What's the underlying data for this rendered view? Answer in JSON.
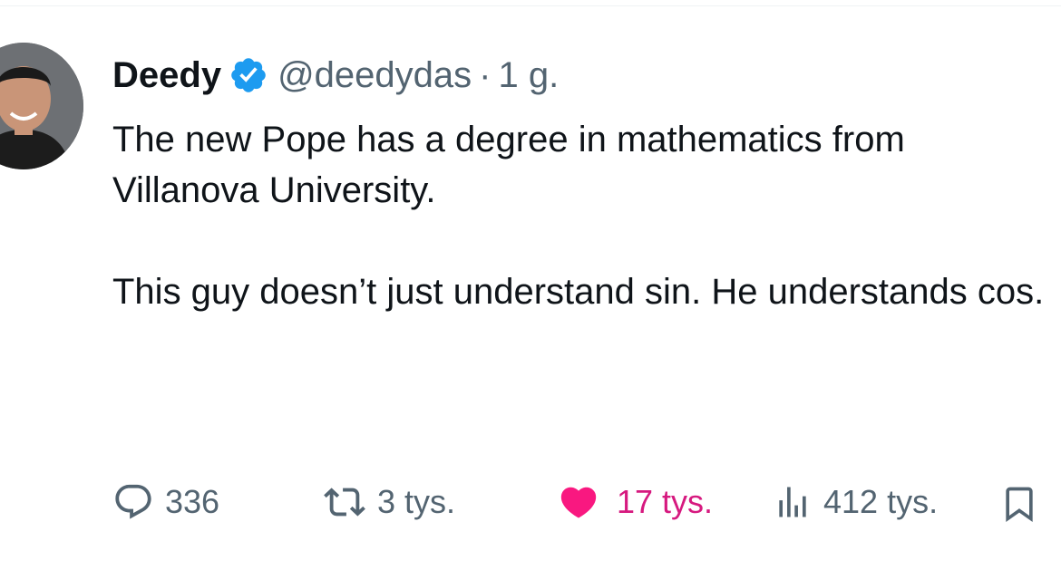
{
  "tweet": {
    "author": {
      "name": "Deedy",
      "handle": "@deedydas",
      "verified": true,
      "verified_icon": "verified-badge-icon"
    },
    "separator": "·",
    "time": "1 g.",
    "paragraphs": [
      "The new Pope has a degree in mathematics from Villanova University.",
      "This guy doesn’t just understand sin. He understands cos."
    ],
    "actions": {
      "replies": {
        "icon": "reply-icon",
        "count": "336"
      },
      "retweets": {
        "icon": "retweet-icon",
        "count": "3 tys."
      },
      "likes": {
        "icon": "heart-icon",
        "count": "17 tys.",
        "liked": true
      },
      "views": {
        "icon": "views-icon",
        "count": "412 tys."
      },
      "bookmark": {
        "icon": "bookmark-icon"
      }
    }
  },
  "colors": {
    "text": "#0f1419",
    "secondary": "#536471",
    "verified": "#1d9bf0",
    "like": "#f91880",
    "like_text": "#d6197f"
  }
}
